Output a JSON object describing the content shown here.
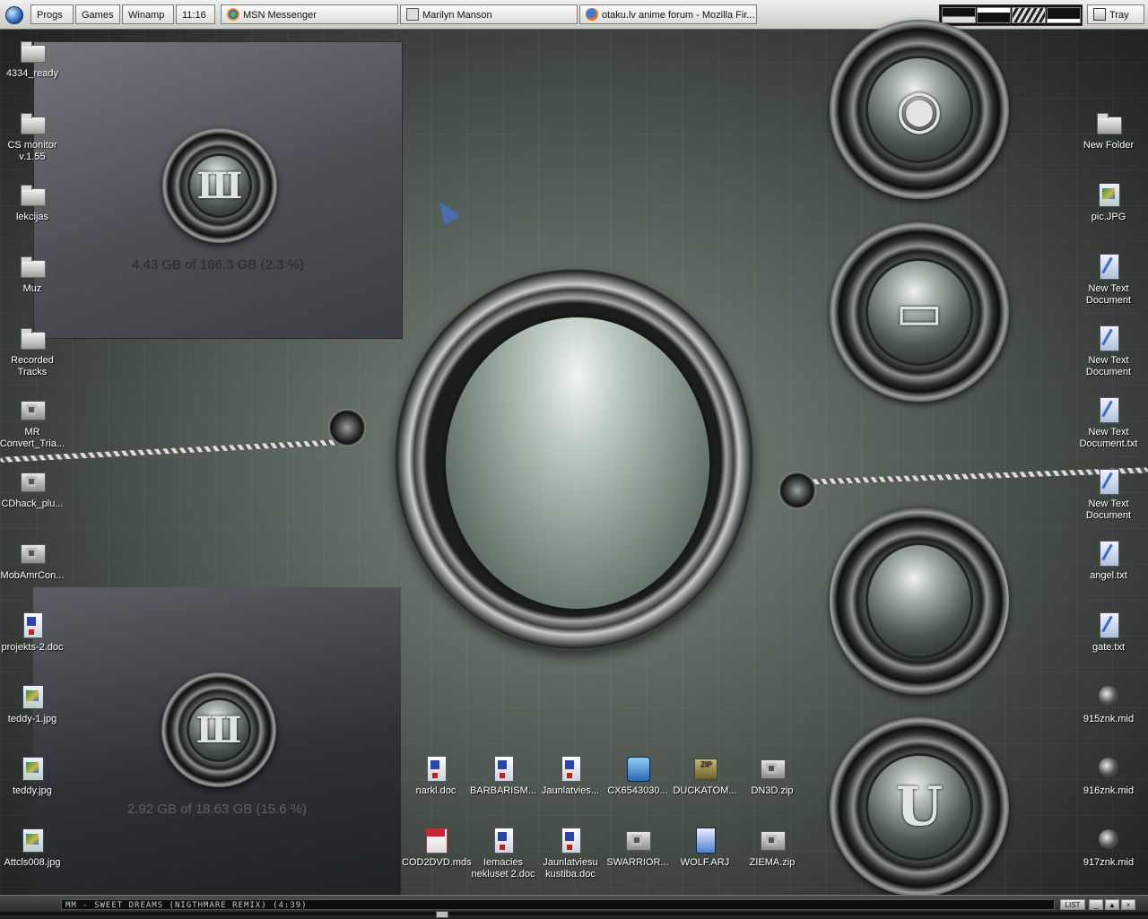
{
  "taskbar": {
    "start_menus": [
      {
        "label": "Progs"
      },
      {
        "label": "Games"
      },
      {
        "label": "Winamp"
      }
    ],
    "clock": "11:16",
    "tasks": [
      {
        "label": "MSN Messenger",
        "icon": "msn-icon"
      },
      {
        "label": "Marilyn Manson",
        "icon": "folder-icon"
      },
      {
        "label": "otaku.lv anime forum - Mozilla Fir...",
        "icon": "firefox-icon"
      }
    ],
    "tray_label": "Tray"
  },
  "drives": [
    {
      "label": "4.43 GB of 186.3 GB (2.3 %)",
      "used_percent": 2.3
    },
    {
      "label": "2.92 GB of 18.63 GB (15.6 %)",
      "used_percent": 15.6
    }
  ],
  "icons_left": [
    {
      "label": "4334_ready",
      "type": "folder"
    },
    {
      "label": "CS monitor v.1.55",
      "type": "folder"
    },
    {
      "label": "lekcijas",
      "type": "folder"
    },
    {
      "label": "Muz",
      "type": "folder"
    },
    {
      "label": "Recorded Tracks",
      "type": "folder"
    },
    {
      "label": "MR Convert_Tria...",
      "type": "exe"
    },
    {
      "label": "CDhack_plu...",
      "type": "exe"
    },
    {
      "label": "MobAmrCon...",
      "type": "exe"
    },
    {
      "label": "projekts-2.doc",
      "type": "doc"
    },
    {
      "label": "teddy-1.jpg",
      "type": "img"
    },
    {
      "label": "teddy.jpg",
      "type": "img"
    },
    {
      "label": "Attcls008.jpg",
      "type": "img"
    }
  ],
  "icons_right": [
    {
      "label": "New Folder",
      "type": "folder"
    },
    {
      "label": "pic.JPG",
      "type": "img"
    },
    {
      "label": "New Text Document",
      "type": "txt"
    },
    {
      "label": "New Text Document",
      "type": "txt"
    },
    {
      "label": "New Text Document.txt",
      "type": "txt"
    },
    {
      "label": "New Text Document",
      "type": "txt"
    },
    {
      "label": "angel.txt",
      "type": "txt"
    },
    {
      "label": "gate.txt",
      "type": "txt"
    },
    {
      "label": "915znk.mid",
      "type": "mid"
    },
    {
      "label": "916znk.mid",
      "type": "mid"
    },
    {
      "label": "917znk.mid",
      "type": "mid"
    }
  ],
  "icons_bottom": [
    {
      "label": "narkl.doc",
      "type": "doc"
    },
    {
      "label": "BARBARISM...",
      "type": "doc"
    },
    {
      "label": "Jaunlatvies...",
      "type": "doc"
    },
    {
      "label": "CX6543030...",
      "type": "cx"
    },
    {
      "label": "DUCKATOM...",
      "type": "zip"
    },
    {
      "label": "DN3D.zip",
      "type": "exe"
    },
    {
      "label": "COD2DVD.mds",
      "type": "mds"
    },
    {
      "label": "Iemacies nekluset 2.doc",
      "type": "doc"
    },
    {
      "label": "Jaunlatviesu kustiba.doc",
      "type": "doc"
    },
    {
      "label": "SWARRIOR...",
      "type": "exe"
    },
    {
      "label": "WOLF.ARJ",
      "type": "arj"
    },
    {
      "label": "ZIEMA.zip",
      "type": "exe"
    }
  ],
  "player": {
    "track": "MM - SWEET DREAMS (NIGTHMARE REMIX) (4:39)",
    "list_label": "LIST"
  },
  "colors": {
    "accent": "#4a6db0",
    "desktop": "#56605a"
  }
}
